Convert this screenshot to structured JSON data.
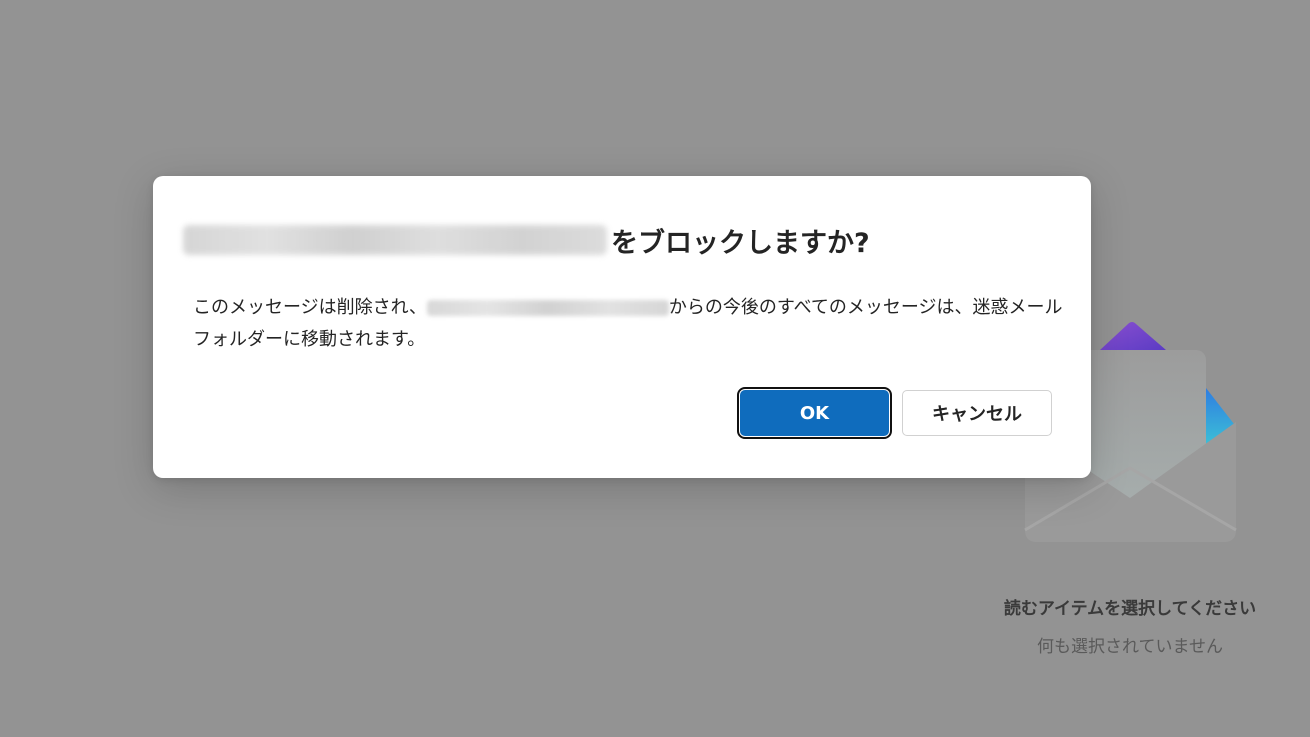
{
  "dialog": {
    "title_suffix": "をブロックしますか?",
    "body_part1": "このメッセージは削除され、",
    "body_part2": "からの今後のすべてのメッセージは、迷惑メール フォルダーに移動されます。",
    "ok_label": "OK",
    "cancel_label": "キャンセル"
  },
  "reading_pane": {
    "empty_title": "読むアイテムを選択してください",
    "empty_subtitle": "何も選択されていません",
    "illustration_icon": "open-envelope-icon"
  },
  "colors": {
    "backdrop": "#939393",
    "primary_button": "#0f6cbd",
    "dialog_bg": "#ffffff"
  }
}
